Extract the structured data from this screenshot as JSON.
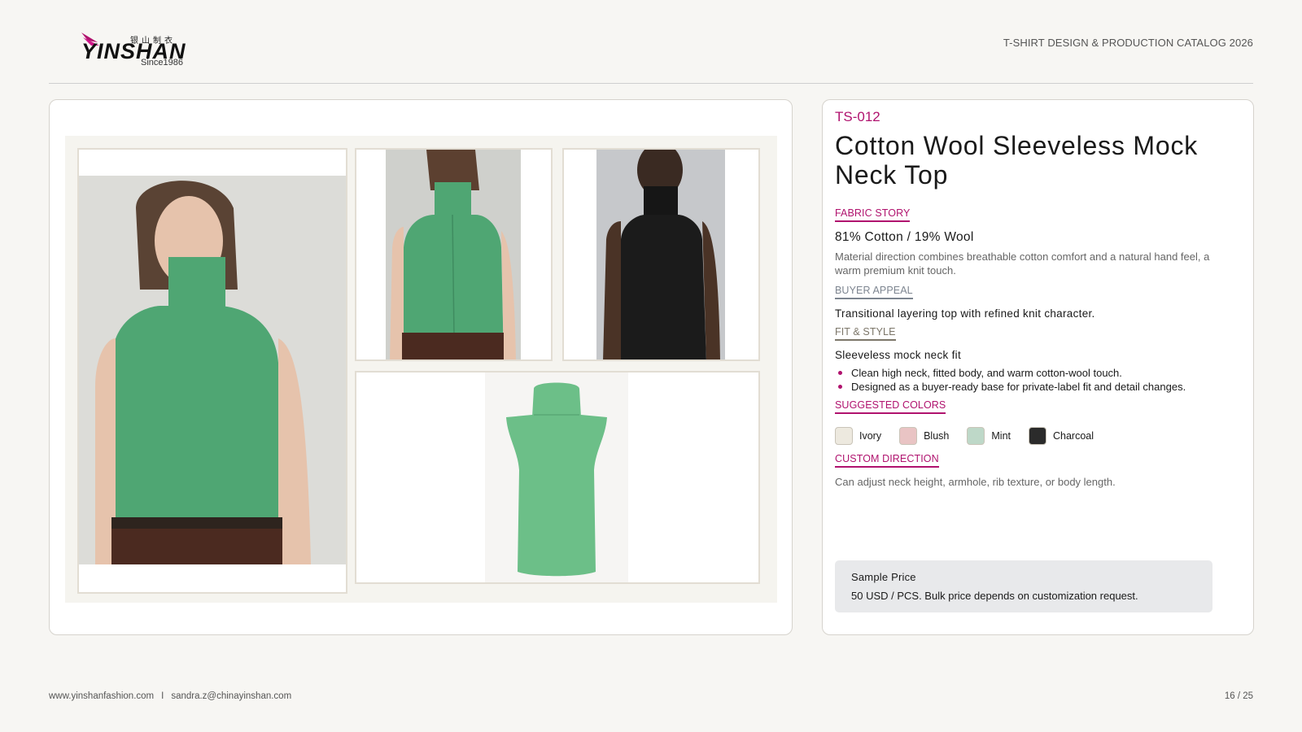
{
  "header": {
    "logo": {
      "brand": "YINSHAN",
      "chinese": "银山制衣",
      "since": "Since1986"
    },
    "catalog_title": "T-SHIRT DESIGN & PRODUCTION CATALOG 2026"
  },
  "product": {
    "sku": "TS-012",
    "name": "Cotton Wool Sleeveless Mock Neck Top",
    "fabric_story": {
      "label": "FABRIC STORY",
      "composition": "81% Cotton / 19% Wool",
      "description": "Material direction combines breathable cotton comfort and a natural hand feel, a warm premium knit touch."
    },
    "buyer_appeal": {
      "label": "BUYER APPEAL",
      "text": "Transitional layering top with refined knit character."
    },
    "fit_style": {
      "label": "FIT & STYLE",
      "fit": "Sleeveless mock neck fit",
      "bullets": [
        "Clean high neck, fitted body, and warm cotton-wool touch.",
        "Designed as a buyer-ready base for private-label fit and detail changes."
      ]
    },
    "suggested_colors": {
      "label": "SUGGESTED COLORS",
      "colors": [
        {
          "name": "Ivory",
          "hex": "#ede9df"
        },
        {
          "name": "Blush",
          "hex": "#e9c4c4"
        },
        {
          "name": "Mint",
          "hex": "#bed8c8"
        },
        {
          "name": "Charcoal",
          "hex": "#2b2b2b"
        }
      ]
    },
    "custom_direction": {
      "label": "CUSTOM DIRECTION",
      "text": "Can adjust neck height, armhole, rib texture, or body length."
    },
    "price": {
      "title": "Sample Price",
      "text": "50 USD / PCS. Bulk price depends on customization request."
    }
  },
  "gallery": {
    "garment_color": "#4fa673",
    "flat_color": "#6cbf88"
  },
  "footer": {
    "website": "www.yinshanfashion.com",
    "separator": "I",
    "email": "sandra.z@chinayinshan.com",
    "page": "16 / 25"
  },
  "colors": {
    "accent": "#b0126e"
  }
}
